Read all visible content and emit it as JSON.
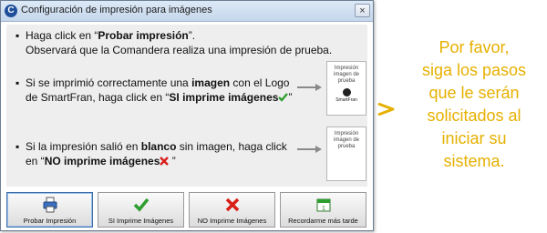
{
  "window": {
    "title": "Configuración de impresión para imágenes",
    "close_glyph": "×",
    "app_icon_letter": "C"
  },
  "instructions": {
    "step1": {
      "line1_pre": "Haga click en “",
      "line1_bold": "Probar impresión",
      "line1_post": "”.",
      "line2": "Observará que la Comandera realiza una impresión de prueba."
    },
    "step2": {
      "line1_pre": "Si se imprimió correctamente una ",
      "line1_bold": "imagen",
      "line1_post": " con el Logo",
      "line2_pre": "de SmartFran, haga click en “",
      "line2_bold": "SI imprime imágenes",
      "line2_post": "”",
      "icon": "check-icon"
    },
    "step3": {
      "line1_pre": "Si la impresión salió en ",
      "line1_bold": "blanco",
      "line1_post": " sin imagen, haga click",
      "line2_pre": "en “",
      "line2_bold": "NO imprime imágenes",
      "line2_post": " ”",
      "icon": "x-icon"
    }
  },
  "thumbnails": {
    "with_image": {
      "line1": "Impresión",
      "line2": "imagen de",
      "line3": "prueba",
      "logo": "SmartFran"
    },
    "blank": {
      "line1": "Impresión",
      "line2": "imagen de",
      "line3": "prueba"
    }
  },
  "buttons": [
    {
      "label": "Probar Impresión",
      "icon": "printer-icon"
    },
    {
      "label": "SI Imprime Imágenes",
      "icon": "check-icon"
    },
    {
      "label": "NO Imprime Imágenes",
      "icon": "x-icon"
    },
    {
      "label": "Recordarme más tarde",
      "icon": "calendar-icon"
    }
  ],
  "side_message": {
    "lines": [
      "Por favor,",
      "siga los pasos",
      "que le serán",
      "solicitados al",
      "iniciar su",
      "sistema."
    ]
  },
  "colors": {
    "accent_yellow": "#e6b000",
    "check_green": "#2e9e2e",
    "x_red": "#d91e18"
  }
}
